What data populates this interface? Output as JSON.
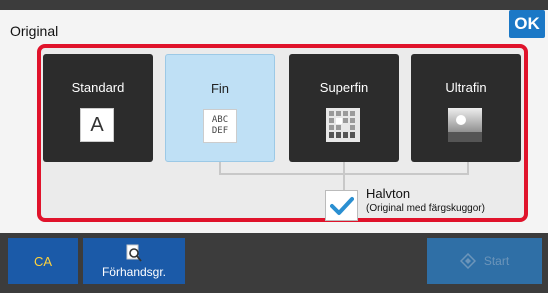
{
  "header": {
    "title": "Original",
    "ok_label": "OK"
  },
  "resolution_options": [
    {
      "label": "Standard",
      "icon": "letter-a-icon",
      "glyph": "A",
      "selected": false
    },
    {
      "label": "Fin",
      "icon": "abc-def-icon",
      "glyph_line1": "ABC",
      "glyph_line2": "DEF",
      "selected": true
    },
    {
      "label": "Superfin",
      "icon": "image-grid-icon",
      "selected": false
    },
    {
      "label": "Ultrafin",
      "icon": "image-grayscale-icon",
      "selected": false
    }
  ],
  "halftone": {
    "checked": true,
    "label": "Halvton",
    "sublabel": "(Original med färgskuggor)"
  },
  "footer": {
    "ca_label": "CA",
    "preview_label": "Förhandsgr.",
    "start_label": "Start"
  },
  "colors": {
    "accent": "#1b78c6",
    "frame": "#e0132b",
    "selected": "#bfe0f5",
    "button": "#1b5aa8",
    "check": "#2a8fd1"
  }
}
